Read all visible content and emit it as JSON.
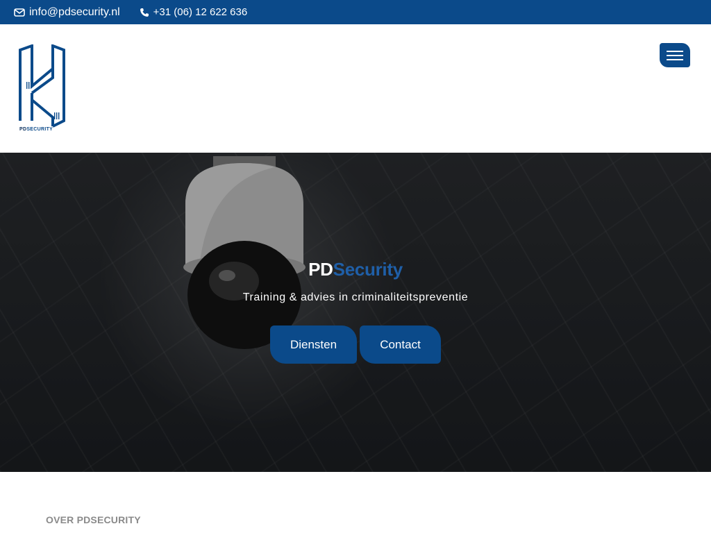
{
  "topbar": {
    "email": "info@pdsecurity.nl",
    "phone": "+31 (06) 12 622 636",
    "email_icon": "envelope-icon",
    "phone_icon": "phone-icon"
  },
  "header": {
    "logo": {
      "text_pd": "PD",
      "text_security": "SECURITY"
    },
    "menu_icon": "hamburger-icon"
  },
  "hero": {
    "title_pd": "PD",
    "title_security": "Security",
    "tagline": "Training & advies in criminaliteitspreventie",
    "buttons": {
      "diensten": "Diensten",
      "contact": "Contact"
    }
  },
  "about": {
    "heading": "OVER PDSECURITY"
  },
  "colors": {
    "brand": "#0b4a8a",
    "accent": "#1f5fa8",
    "muted": "#8a8a8a"
  }
}
